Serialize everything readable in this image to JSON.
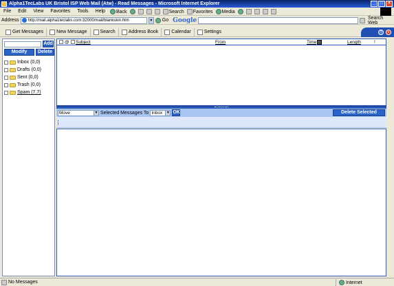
{
  "window": {
    "title": "Alpha1TecLabs UK Bristol ISP Web Mail (Atw) - Read Messages - Microsoft Internet Explorer"
  },
  "menu": [
    "File",
    "Edit",
    "View",
    "Favorites",
    "Tools",
    "Help"
  ],
  "toolbar": {
    "back": "Back",
    "search": "Search",
    "favorites": "Favorites",
    "media": "Media"
  },
  "address": {
    "label": "Address",
    "url": "http://mail.alpha1teclabs.com:32000/mail/blankskin.htm",
    "go": "Go",
    "google": "Google",
    "search_web": "Search Web"
  },
  "app_toolbar": {
    "get_messages": "Get Messages",
    "new_message": "New Message",
    "search": "Search",
    "address_book": "Address Book",
    "calendar": "Calendar",
    "settings": "Settings",
    "help_icon": "?",
    "close_icon": "x"
  },
  "folders_panel": {
    "add": "Add",
    "modify": "Modify",
    "delete": "Delete",
    "folders": [
      {
        "label": "Inbox (0,0)"
      },
      {
        "label": "Drafts (0,0)"
      },
      {
        "label": "Sent (0,0)"
      },
      {
        "label": "Trash (0,0)"
      },
      {
        "label": "Spam (7,7)"
      }
    ]
  },
  "message_list": {
    "columns": {
      "subject": "Subject",
      "from": "From",
      "time": "Time",
      "length": "Length",
      "flag": "!"
    }
  },
  "move_bar": {
    "action": "Move",
    "selected_to": "Selected Messages To",
    "target": "Inbox",
    "ok": "OK",
    "delete_selected": "Delete Selected"
  },
  "status": {
    "text": "No Messages",
    "zone": "Internet"
  }
}
